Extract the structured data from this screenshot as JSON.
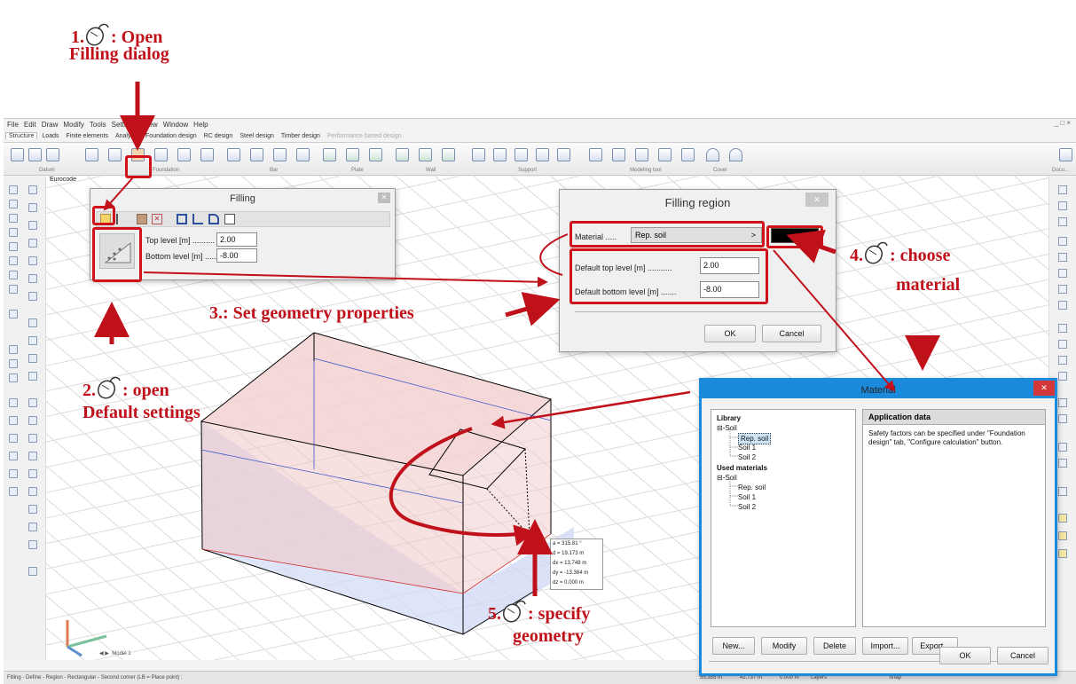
{
  "annotations": {
    "step1_num": "1.",
    "step1_line1": ": Open",
    "step1_line2": "Filling dialog",
    "step2_num": "2.",
    "step2_line1": ": open",
    "step2_line2": "Default settings",
    "step3": "3.: Set geometry properties",
    "step4_num": "4.",
    "step4_line1": ": choose",
    "step4_line2": "material",
    "step5_num": "5.",
    "step5_line1": ": specify",
    "step5_line2": "geometry"
  },
  "app": {
    "menu": [
      "File",
      "Edit",
      "Draw",
      "Modify",
      "Tools",
      "Settings",
      "View",
      "Window",
      "Help"
    ],
    "tabs": [
      "Structure",
      "Loads",
      "Finite elements",
      "Analysis",
      "Foundation design",
      "RC design",
      "Steel design",
      "Timber design",
      "Performance based design"
    ],
    "active_tab": "Structure",
    "ribbon_groups": [
      "Datum",
      "Foundation",
      "Bar",
      "Plate",
      "Wall",
      "Support",
      "Modeling tool",
      "Cover",
      "Docu..."
    ],
    "eurocode": "Eurocode",
    "model_tab": "Model 1",
    "status_text": "Filling - Define - Region - Rectangular - Second corner (LB = Place point) :",
    "status_right": [
      "55.355 m",
      "42.737 m",
      "0.000 m",
      "Layers",
      "Snap"
    ]
  },
  "filling_dialog": {
    "title": "Filling",
    "top_label": "Top level [m] ..........",
    "top_value": "2.00",
    "bottom_label": "Bottom level [m] ......",
    "bottom_value": "-8.00"
  },
  "region_dialog": {
    "title": "Filling region",
    "material_label": "Material .....",
    "material_value": "Rep. soil",
    "material_arrow": ">",
    "default_top_label": "Default top level [m] ...........",
    "default_top_value": "2.00",
    "default_bottom_label": "Default bottom level [m] .......",
    "default_bottom_value": "-8.00",
    "ok": "OK",
    "cancel": "Cancel",
    "material_color": "#000000"
  },
  "material_dialog": {
    "title": "Material",
    "library": "Library",
    "soil": "Soil",
    "lib_items": [
      "Rep. soil",
      "Soil 1",
      "Soil 2"
    ],
    "used": "Used materials",
    "used_items": [
      "Rep. soil",
      "Soil 1",
      "Soil 2"
    ],
    "app_data_title": "Application data",
    "app_data_text": "Safety factors can be specified under \"Foundation design\" tab, \"Configure calculation\" button.",
    "buttons": [
      "New...",
      "Modify",
      "Delete",
      "Import...",
      "Export..."
    ],
    "ok": "OK",
    "cancel": "Cancel",
    "title_color": "#1c8adb"
  },
  "coord_readout": [
    "a  =  315.81 °",
    "d  =  19.173 m",
    "dx =  13.748 m",
    "dy = -13.364 m",
    "dz =    0.000 m"
  ],
  "colors": {
    "annotation_red": "#c0101a",
    "accent_blue": "#1c8adb"
  }
}
